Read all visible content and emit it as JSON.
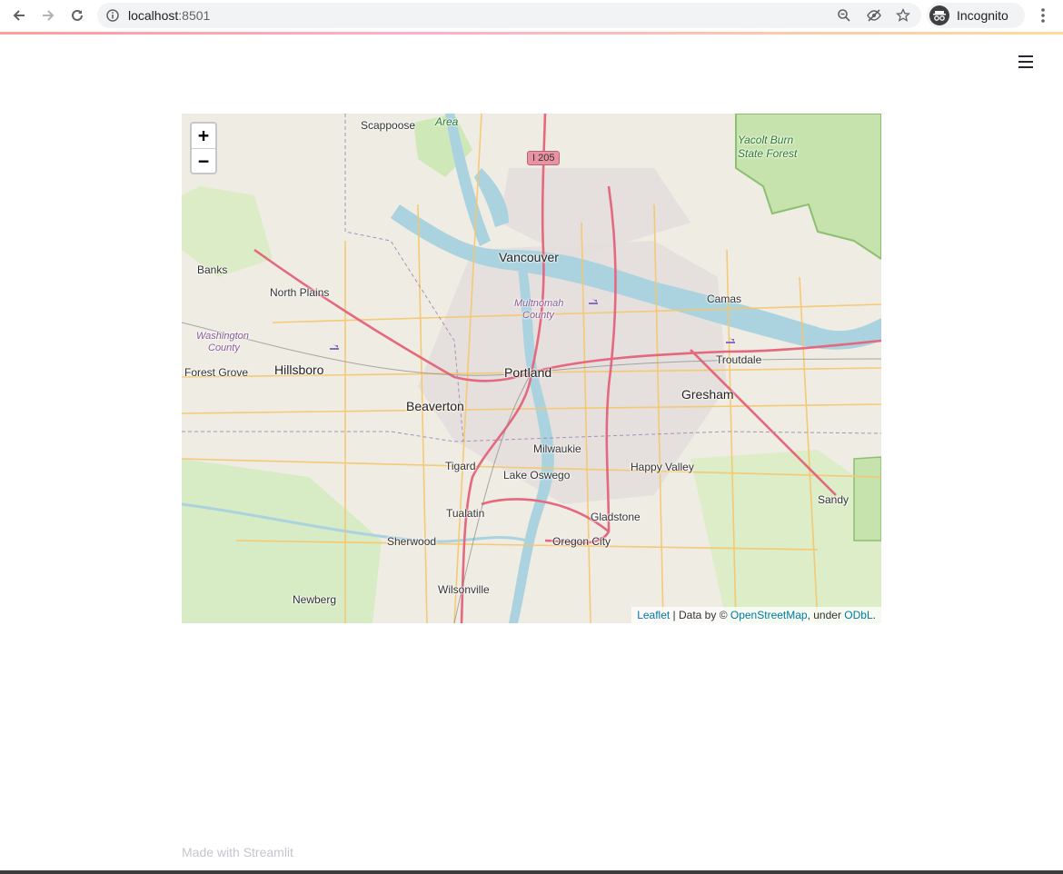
{
  "browser": {
    "url_host": "localhost",
    "url_port": ":8501",
    "profile_label": "Incognito"
  },
  "map": {
    "zoom_in_label": "+",
    "zoom_out_label": "−",
    "highway_shield": "I 205",
    "places": {
      "scappoose": "Scappoose",
      "area": "Area",
      "vancouver": "Vancouver",
      "yacolt": "Yacolt Burn",
      "state_forest": "State Forest",
      "banks": "Banks",
      "north_plains": "North Plains",
      "multnomah": "Multnomah",
      "county": "County",
      "camas": "Camas",
      "washington": "Washington",
      "washington_county": "County",
      "troutdale": "Troutdale",
      "forest_grove": "Forest Grove",
      "hillsboro": "Hillsboro",
      "portland": "Portland",
      "beaverton": "Beaverton",
      "gresham": "Gresham",
      "milwaukie": "Milwaukie",
      "tigard": "Tigard",
      "lake_oswego": "Lake Oswego",
      "happy_valley": "Happy Valley",
      "sandy": "Sandy",
      "tualatin": "Tualatin",
      "gladstone": "Gladstone",
      "sherwood": "Sherwood",
      "oregon_city": "Oregon City",
      "wilsonville": "Wilsonville",
      "newberg": "Newberg"
    },
    "attribution": {
      "leaflet": "Leaflet",
      "data_by": " | Data by © ",
      "osm": "OpenStreetMap",
      "under": ", under ",
      "odbl": "ODbL",
      "period": "."
    }
  },
  "footer": {
    "made_with": "Made with Streamlit"
  },
  "colors": {
    "accent": "#ff4b4b",
    "link": "#0078a8",
    "river": "#aad3df",
    "park": "#c8e6b0",
    "highway": "#e4687e",
    "arterial": "#f6c66a"
  }
}
